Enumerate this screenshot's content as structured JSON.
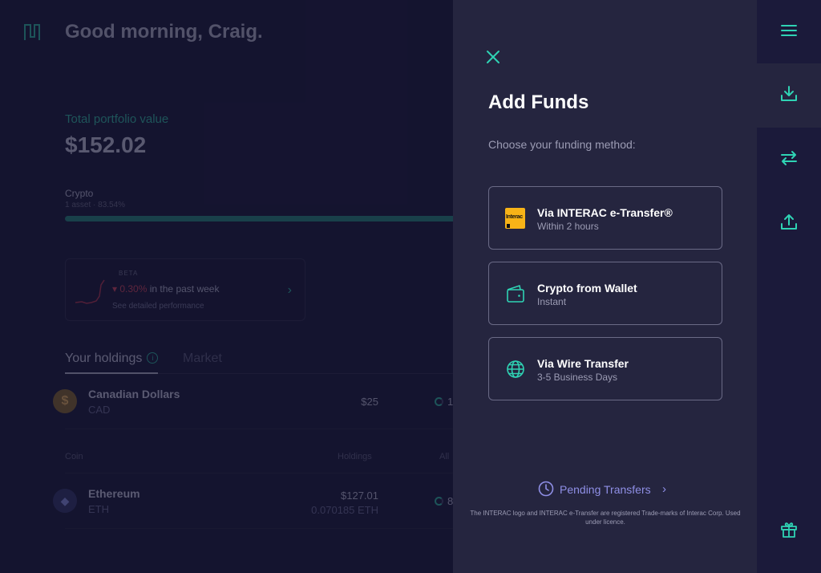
{
  "app": {
    "greeting": "Good morning, Craig."
  },
  "portfolio": {
    "label": "Total portfolio value",
    "value": "$152.02",
    "crypto_label": "Crypto",
    "crypto_sub": "1 asset · 83.54%"
  },
  "performance": {
    "badge": "BETA",
    "change": "0.30%",
    "period": "in the past week",
    "link": "See detailed performance",
    "direction_icon": "triangle-down-icon"
  },
  "tabs": {
    "holdings": "Your holdings",
    "market": "Market"
  },
  "holdings": {
    "cad": {
      "name": "Canadian Dollars",
      "symbol": "CAD",
      "amount": "$25",
      "alloc": "1"
    },
    "header": {
      "coin": "Coin",
      "holdings": "Holdings",
      "alloc": "All"
    },
    "eth": {
      "name": "Ethereum",
      "symbol": "ETH",
      "amount": "$127.01",
      "amount_crypto": "0.070185 ETH",
      "alloc": "8"
    }
  },
  "add_funds": {
    "title": "Add Funds",
    "subtitle": "Choose your funding method:",
    "methods": [
      {
        "title": "Via INTERAC e-Transfer®",
        "subtitle": "Within 2 hours",
        "icon": "interac-logo",
        "logo_text": "Interac"
      },
      {
        "title": "Crypto from Wallet",
        "subtitle": "Instant",
        "icon": "wallet-icon"
      },
      {
        "title": "Via Wire Transfer",
        "subtitle": "3-5 Business Days",
        "icon": "globe-icon"
      }
    ],
    "pending_label": "Pending Transfers",
    "legal": "The INTERAC logo and INTERAC e-Transfer are registered Trade-marks of Interac Corp. Used under licence."
  },
  "rail": {
    "icons": [
      "menu-icon",
      "download-icon",
      "transfer-arrows-icon",
      "upload-icon",
      "gift-icon"
    ]
  },
  "colors": {
    "accent": "#2fd3b4",
    "panel_bg": "#25253f",
    "main_bg": "#1b1a3a",
    "pending_link": "#8f8fe6",
    "negative": "#a03a52",
    "interac_yellow": "#f7b317"
  }
}
